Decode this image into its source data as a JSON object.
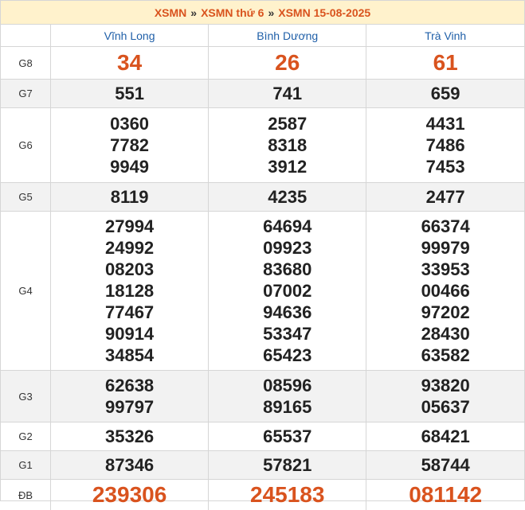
{
  "breadcrumb": {
    "items": [
      "XSMN",
      "XSMN thứ 6",
      "XSMN 15-08-2025"
    ],
    "separator": "»"
  },
  "provinces": [
    "Vĩnh Long",
    "Bình Dương",
    "Trà Vinh"
  ],
  "prizes": [
    {
      "label": "G8",
      "style": "big",
      "alt": false,
      "values": [
        [
          "34"
        ],
        [
          "26"
        ],
        [
          "61"
        ]
      ]
    },
    {
      "label": "G7",
      "style": "normal",
      "alt": true,
      "values": [
        [
          "551"
        ],
        [
          "741"
        ],
        [
          "659"
        ]
      ]
    },
    {
      "label": "G6",
      "style": "normal",
      "alt": false,
      "values": [
        [
          "0360",
          "7782",
          "9949"
        ],
        [
          "2587",
          "8318",
          "3912"
        ],
        [
          "4431",
          "7486",
          "7453"
        ]
      ]
    },
    {
      "label": "G5",
      "style": "normal",
      "alt": true,
      "values": [
        [
          "8119"
        ],
        [
          "4235"
        ],
        [
          "2477"
        ]
      ]
    },
    {
      "label": "G4",
      "style": "normal",
      "alt": false,
      "values": [
        [
          "27994",
          "24992",
          "08203",
          "18128",
          "77467",
          "90914",
          "34854"
        ],
        [
          "64694",
          "09923",
          "83680",
          "07002",
          "94636",
          "53347",
          "65423"
        ],
        [
          "66374",
          "99979",
          "33953",
          "00466",
          "97202",
          "28430",
          "63582"
        ]
      ]
    },
    {
      "label": "G3",
      "style": "normal",
      "alt": true,
      "values": [
        [
          "62638",
          "99797"
        ],
        [
          "08596",
          "89165"
        ],
        [
          "93820",
          "05637"
        ]
      ]
    },
    {
      "label": "G2",
      "style": "normal",
      "alt": false,
      "values": [
        [
          "35326"
        ],
        [
          "65537"
        ],
        [
          "68421"
        ]
      ]
    },
    {
      "label": "G1",
      "style": "normal",
      "alt": true,
      "values": [
        [
          "87346"
        ],
        [
          "57821"
        ],
        [
          "58744"
        ]
      ]
    },
    {
      "label": "ĐB",
      "style": "special",
      "alt": false,
      "values": [
        [
          "239306"
        ],
        [
          "245183"
        ],
        [
          "081142"
        ]
      ]
    }
  ],
  "colors": {
    "accent": "#d9531e",
    "header_bg": "#fff2cc",
    "province_link": "#1f5fa8",
    "alt_row": "#f2f2f2",
    "border": "#d6d6d6"
  }
}
